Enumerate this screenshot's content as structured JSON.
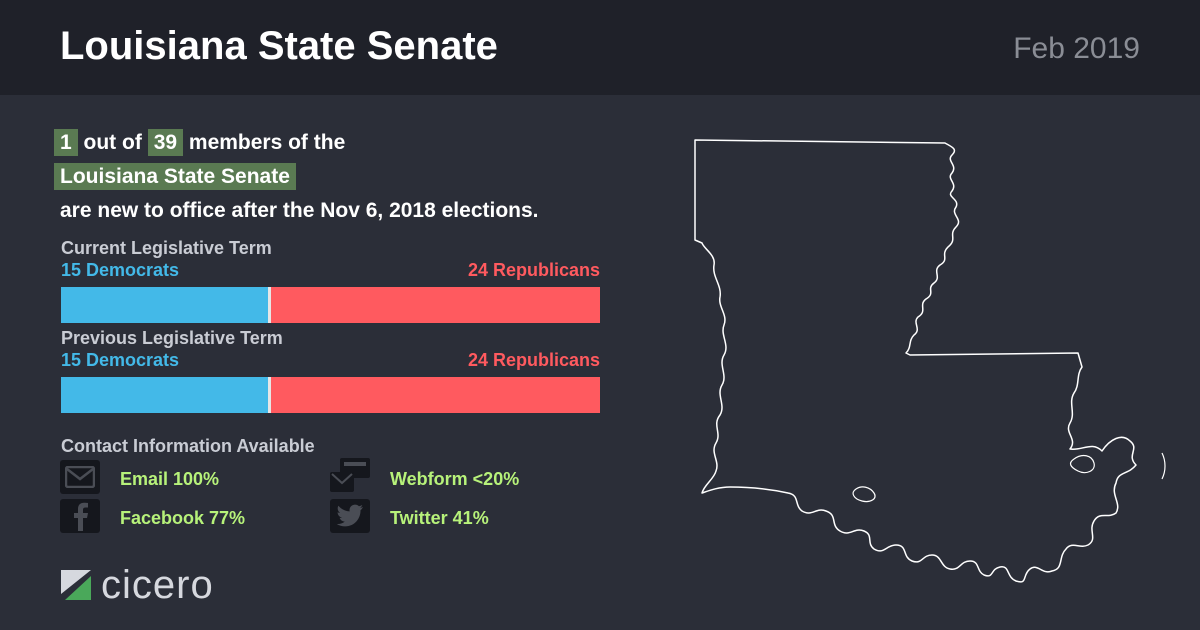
{
  "header": {
    "title": "Louisiana State Senate",
    "date": "Feb 2019"
  },
  "headline": {
    "new_count": "1",
    "out_of_text": "out of",
    "total": "39",
    "members_text": "members of the",
    "body_name": "Louisiana State Senate",
    "tail_text": "are new to office after the Nov 6, 2018 elections."
  },
  "current_term": {
    "label": "Current Legislative Term",
    "democrats_label": "15 Democrats",
    "republicans_label": "24 Republicans",
    "democrats": 15,
    "republicans": 24
  },
  "previous_term": {
    "label": "Previous Legislative Term",
    "democrats_label": "15 Democrats",
    "republicans_label": "24 Republicans",
    "democrats": 15,
    "republicans": 24
  },
  "contact": {
    "title": "Contact Information Available",
    "items": [
      {
        "label": "Email 100%",
        "icon": "email-icon"
      },
      {
        "label": "Webform <20%",
        "icon": "webform-icon"
      },
      {
        "label": "Facebook 77%",
        "icon": "facebook-icon"
      },
      {
        "label": "Twitter 41%",
        "icon": "twitter-icon"
      }
    ]
  },
  "logo": {
    "text": "cicero"
  },
  "colors": {
    "democrat": "#43b9e8",
    "republican": "#ff5a5f",
    "highlight": "#5a7a52",
    "contact_text": "#b7f27a"
  }
}
